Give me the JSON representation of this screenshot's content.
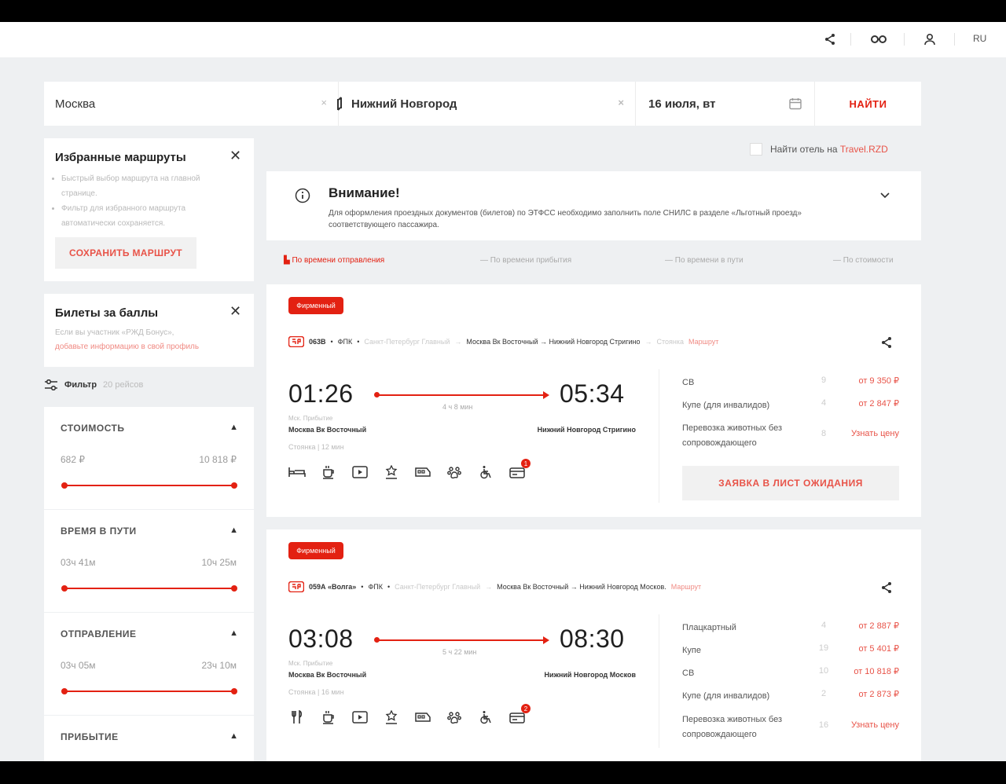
{
  "header": {
    "lang": "RU"
  },
  "search": {
    "from": "Москва",
    "to": "Нижний Новгород",
    "date": "16 июля, вт",
    "find_label": "НАЙТИ",
    "clear": "×"
  },
  "favorites": {
    "title": "Избранные маршруты",
    "items": [
      "Быстрый выбор маршрута на главной странице.",
      "Фильтр для избранного маршрута автоматически сохраняется."
    ],
    "save_label": "СОХРАНИТЬ МАРШРУТ"
  },
  "points": {
    "title": "Билеты за баллы",
    "text_1": "Если вы участник «РЖД Бонус»,",
    "text_2_link": "добавьте информацию в свой профиль"
  },
  "filter": {
    "label": "Фильтр",
    "count": "20 рейсов",
    "sections": [
      {
        "title": "СТОИМОСТЬ",
        "min": "682 ₽",
        "max": "10 818 ₽"
      },
      {
        "title": "ВРЕМЯ В ПУТИ",
        "min": "03ч 41м",
        "max": "10ч 25м"
      },
      {
        "title": "ОТПРАВЛЕНИЕ",
        "min": "03ч 05м",
        "max": "23ч 10м"
      },
      {
        "title": "ПРИБЫТИЕ"
      }
    ]
  },
  "hotel": {
    "text": "Найти отель на ",
    "link": "Travel.RZD"
  },
  "alert": {
    "title": "Внимание!",
    "text": "Для оформления проездных документов (билетов) по ЭТФСС необходимо заполнить поле СНИЛС в разделе «Льготный проезд» соответствующего пассажира."
  },
  "sort": [
    "По времени отправления",
    "По времени прибытия",
    "По времени в пути",
    "По стоимости"
  ],
  "trains": [
    {
      "tag": "Фирменный",
      "number": "063В",
      "carrier": "ФПК",
      "route_grey": "Санкт-Петербург Главный",
      "from_to": "Москва Вк Восточный → Нижний Новгород Стригино",
      "route_tail_grey": "Стоянка",
      "route_tail_red": "Маршрут",
      "dep": "01:26",
      "arr": "05:34",
      "duration": "4 ч 8 мин",
      "dep_sub": "Мск. Прибытие",
      "dep_station": "Москва Вк Восточный",
      "arr_station": "Нижний Новгород Стригино",
      "stop": "Стоянка | 12 мин",
      "classes": [
        {
          "name": "СВ",
          "count": "9",
          "price": "от 9 350 ₽"
        },
        {
          "name": "Купе (для инвалидов)",
          "count": "4",
          "price": "от 2 847 ₽"
        },
        {
          "name": "Перевозка животных без сопровождающего",
          "count": "8",
          "price": "Узнать цену"
        }
      ],
      "wait_label": "ЗАЯВКА В ЛИСТ ОЖИДАНИЯ",
      "badge": "1"
    },
    {
      "tag": "Фирменный",
      "number": "059А «Волга»",
      "carrier": "ФПК",
      "route_grey": "Санкт-Петербург Главный",
      "from_to": "Москва Вк Восточный → Нижний Новгород Москов.",
      "route_tail_red": "Маршрут",
      "dep": "03:08",
      "arr": "08:30",
      "duration": "5 ч 22 мин",
      "dep_sub": "Мск. Прибытие",
      "dep_station": "Москва Вк Восточный",
      "arr_station": "Нижний Новгород Москов",
      "stop": "Стоянка | 16 мин",
      "classes": [
        {
          "name": "Плацкартный",
          "count": "4",
          "price": "от 2 887 ₽"
        },
        {
          "name": "Купе",
          "count": "19",
          "price": "от 5 401 ₽"
        },
        {
          "name": "СВ",
          "count": "10",
          "price": "от 10 818 ₽"
        },
        {
          "name": "Купе (для инвалидов)",
          "count": "2",
          "price": "от 2 873 ₽"
        },
        {
          "name": "Перевозка животных без сопровождающего",
          "count": "16",
          "price": "Узнать цену"
        }
      ],
      "badge": "2"
    }
  ]
}
